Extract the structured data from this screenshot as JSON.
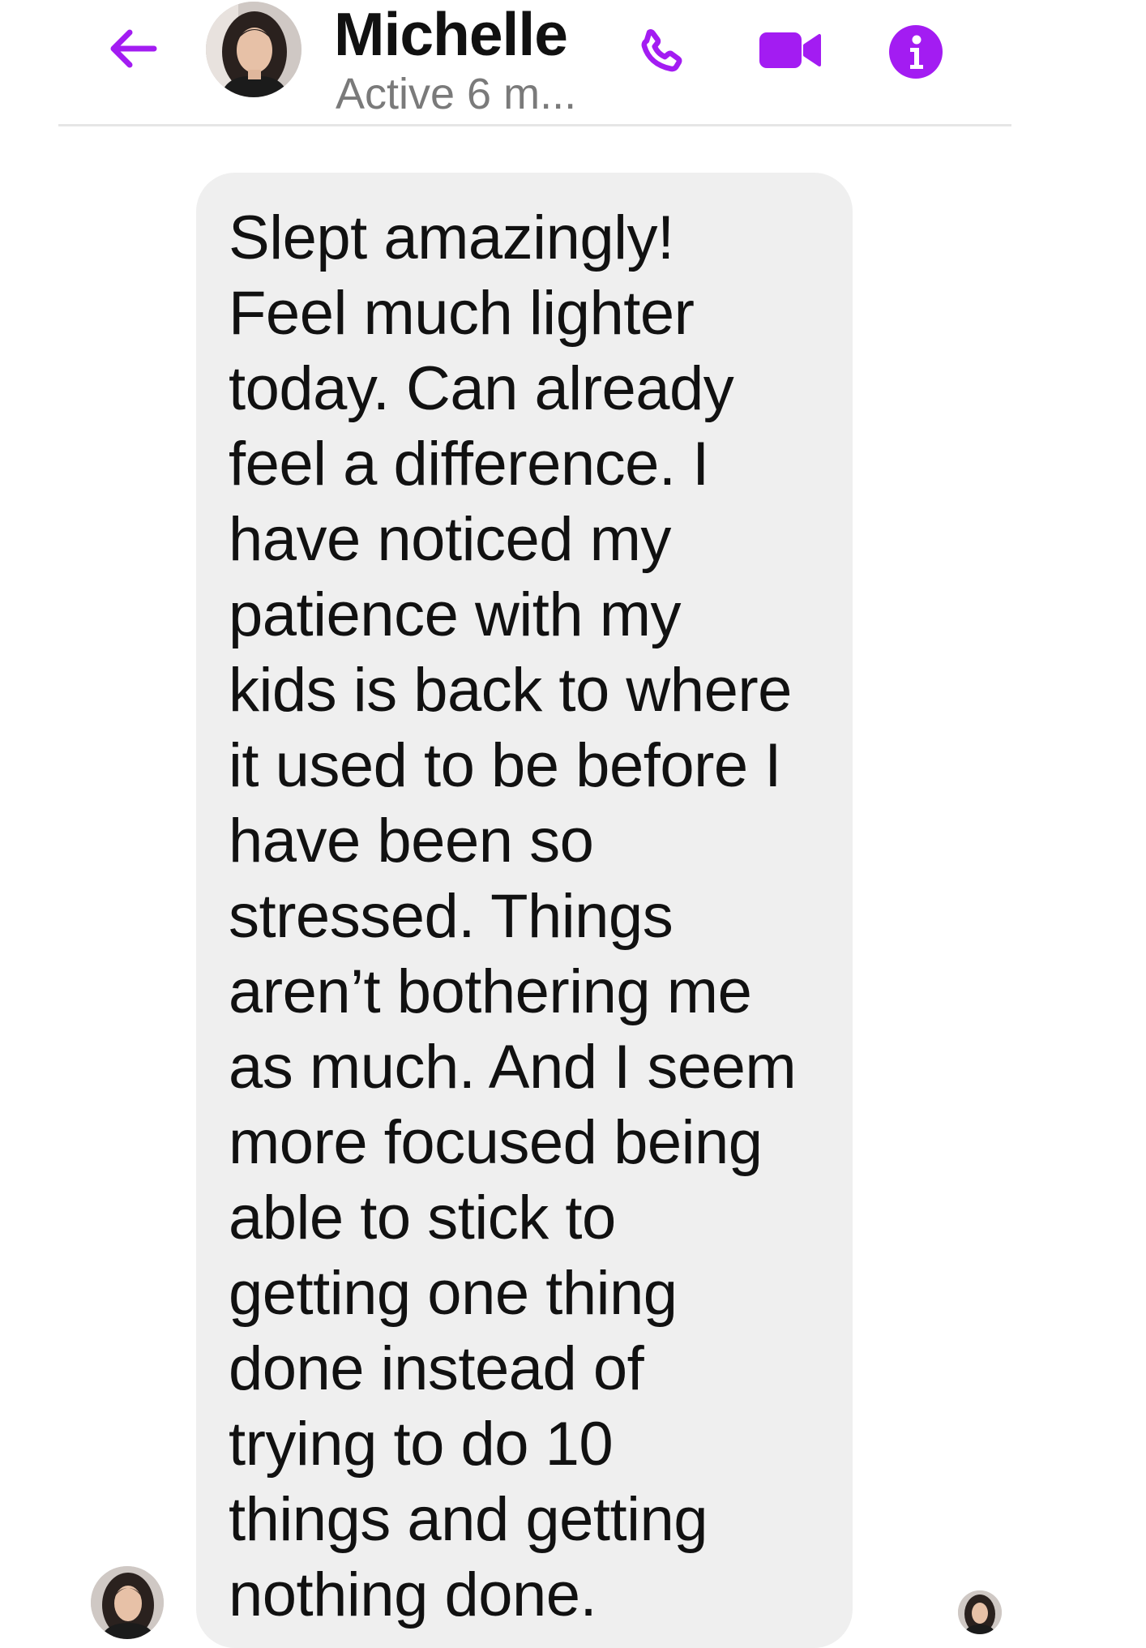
{
  "header": {
    "contact_name": "Michelle",
    "status": "Active 6 m...",
    "icons": {
      "back": "arrow-left-icon",
      "call": "phone-icon",
      "video": "video-camera-icon",
      "info": "info-icon"
    },
    "accent_color": "#a31cf2"
  },
  "conversation": {
    "messages": [
      {
        "sender": "Michelle",
        "text": "Slept amazingly!\nFeel much lighter\ntoday. Can already\nfeel a difference. I\nhave noticed my\npatience with my\nkids is back to where\nit used to be before I\nhave been so\nstressed. Things\naren’t bothering me\nas much. And I seem\nmore focused being\nable to stick to\ngetting one thing\ndone instead of\ntrying to do 10\nthings and getting\nnothing done."
      }
    ]
  },
  "colors": {
    "bubble_background": "#efefef",
    "divider": "#e6e6e6"
  }
}
